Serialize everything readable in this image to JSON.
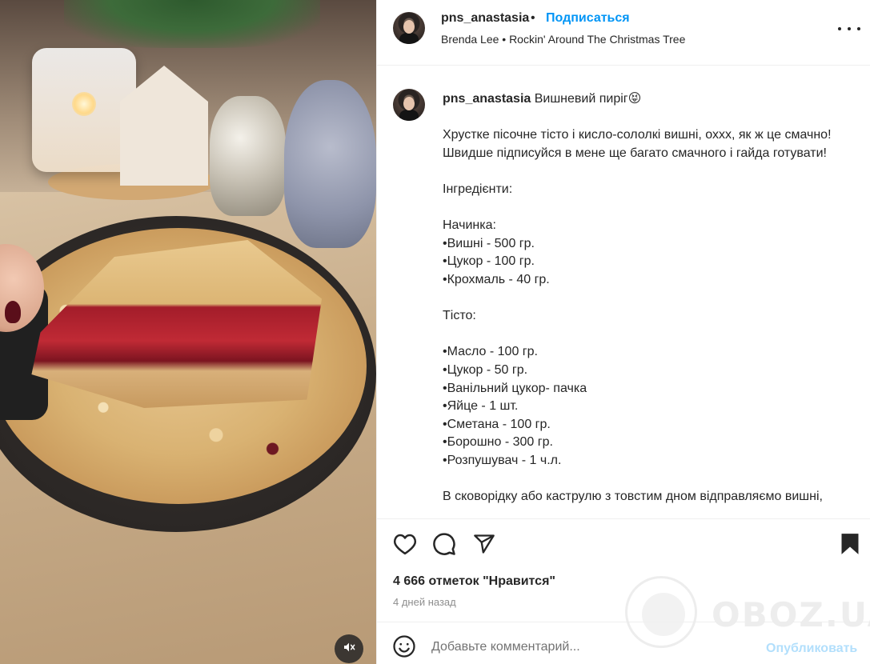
{
  "header": {
    "username": "pns_anastasia",
    "separator": "•",
    "follow_label": "Подписаться",
    "music": "Brenda Lee • Rockin' Around The Christmas Tree"
  },
  "caption": {
    "username": "pns_anastasia",
    "title": "Вишневий пиріг😝",
    "body": "Хрустке пісочне тісто і кисло-сололкі вишні, оххх, як ж це смачно! Швидше підписуйся в мене ще багато смачного і гайда готувати!\n\nІнгредієнти:\n\nНачинка:\n•Вишні - 500 гр.\n•Цукор - 100 гр.\n•Крохмаль - 40 гр.\n\nТісто:\n\n•Масло - 100 гр.\n•Цукор - 50 гр.\n•Ванільний цукор- пачка\n•Яйце - 1 шт.\n•Сметана - 100 гр.\n•Борошно - 300 гр.\n•Розпушувач - 1 ч.л.\n\nВ сковорідку або каструлю з товстим дном відправляємо вишні,"
  },
  "stats": {
    "likes": "4 666 отметок \"Нравится\"",
    "age": "4 дней назад"
  },
  "comment": {
    "placeholder": "Добавьте комментарий...",
    "publish_label": "Опубликовать"
  },
  "watermark": {
    "text": "OBOZ.UA"
  },
  "icons": {
    "like": "heart-icon",
    "comment": "comment-icon",
    "share": "send-icon",
    "save": "bookmark-icon",
    "mute": "speaker-muted-icon",
    "more": "more-horizontal-icon",
    "emoji": "emoji-icon"
  },
  "colors": {
    "accent": "#0095f6",
    "publish_disabled": "#b2dffc",
    "text": "#262626",
    "muted": "#8e8e8e"
  }
}
